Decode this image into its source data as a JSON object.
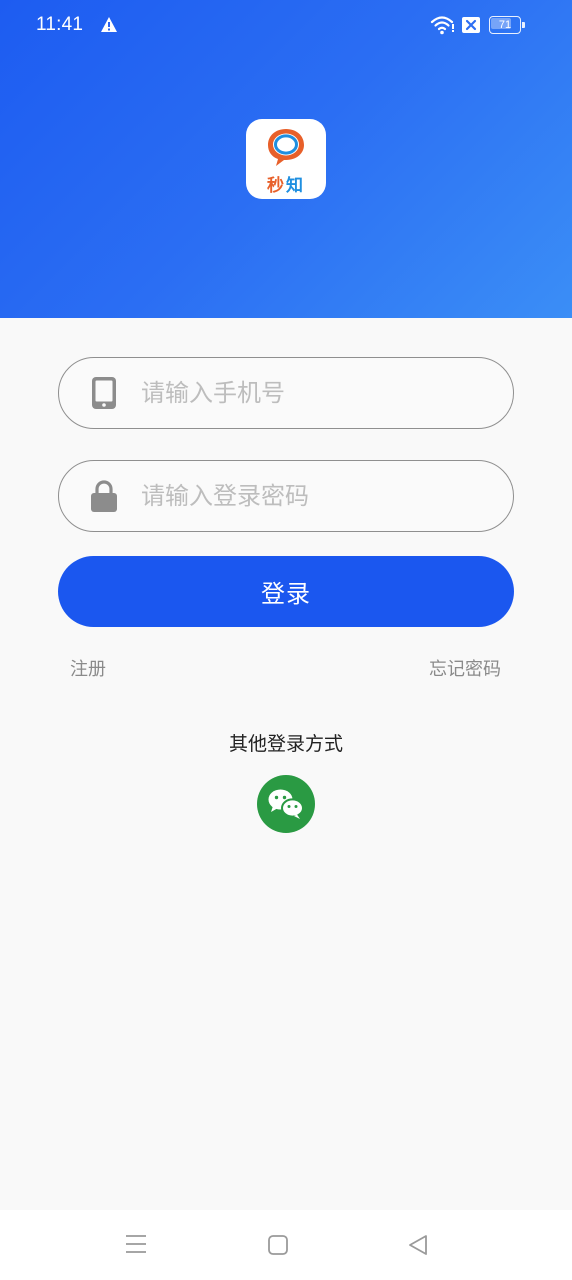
{
  "status_bar": {
    "time": "11:41",
    "battery_level": "71",
    "battery_fraction": 0.71
  },
  "logo": {
    "text_char1": "秒",
    "text_char2": "知",
    "colors": {
      "orange": "#e8602a",
      "blue": "#1f8fe0"
    }
  },
  "form": {
    "phone_placeholder": "请输入手机号",
    "phone_value": "",
    "password_placeholder": "请输入登录密码",
    "password_value": "",
    "login_label": "登录",
    "register_label": "注册",
    "forgot_label": "忘记密码"
  },
  "other_login": {
    "title": "其他登录方式",
    "methods": [
      "wechat-icon"
    ]
  },
  "nav_bar": {
    "icons": [
      "menu-icon",
      "home-icon",
      "back-icon"
    ]
  },
  "colors": {
    "header_start": "#1d5cf1",
    "header_end": "#3b8ef6",
    "primary_button": "#1b57ef",
    "wechat_green": "#2a9a43",
    "background": "#f9f9f9"
  }
}
